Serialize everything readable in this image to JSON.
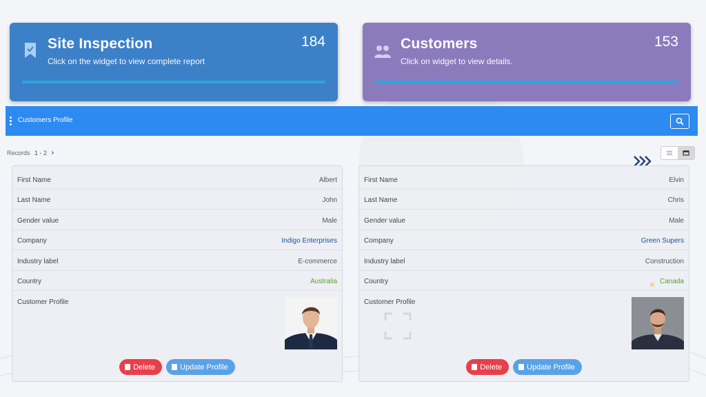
{
  "widgets": {
    "site": {
      "title": "Site Inspection",
      "subtitle": "Click on the widget to view complete report",
      "count": "184",
      "icon": "bookmark-check-icon"
    },
    "customers": {
      "title": "Customers",
      "subtitle": "Click on widget to view details.",
      "count": "153",
      "icon": "users-icon"
    }
  },
  "panel": {
    "title": "Customers Profile",
    "search_icon": "search-icon"
  },
  "records": {
    "label": "Records",
    "range": "1 - 2"
  },
  "cards": [
    {
      "rows": [
        {
          "label": "First Name",
          "value": "Albert"
        },
        {
          "label": "Last Name",
          "value": "John"
        },
        {
          "label": "Gender value",
          "value": "Male"
        },
        {
          "label": "Company",
          "value": "Indigo Enterprises"
        },
        {
          "label": "Industry label",
          "value": "E-commerce"
        },
        {
          "label": "Country",
          "value": "Australia"
        }
      ],
      "profile_label": "Customer Profile",
      "delete_label": "Delete",
      "update_label": "Update Profile"
    },
    {
      "rows": [
        {
          "label": "First Name",
          "value": "Elvin"
        },
        {
          "label": "Last Name",
          "value": "Chris"
        },
        {
          "label": "Gender value",
          "value": "Male"
        },
        {
          "label": "Company",
          "value": "Green Supers"
        },
        {
          "label": "Industry label",
          "value": "Construction"
        },
        {
          "label": "Country",
          "value": "Canada"
        }
      ],
      "profile_label": "Customer Profile",
      "delete_label": "Delete",
      "update_label": "Update Profile"
    }
  ],
  "colors": {
    "site_widget": "#3c80c8",
    "customers_widget": "#8b7bbd",
    "header": "#2d8af0",
    "delete": "#e8404a",
    "update": "#5aa2e6",
    "link": "#1d4f9c",
    "country": "#5aa02c"
  }
}
